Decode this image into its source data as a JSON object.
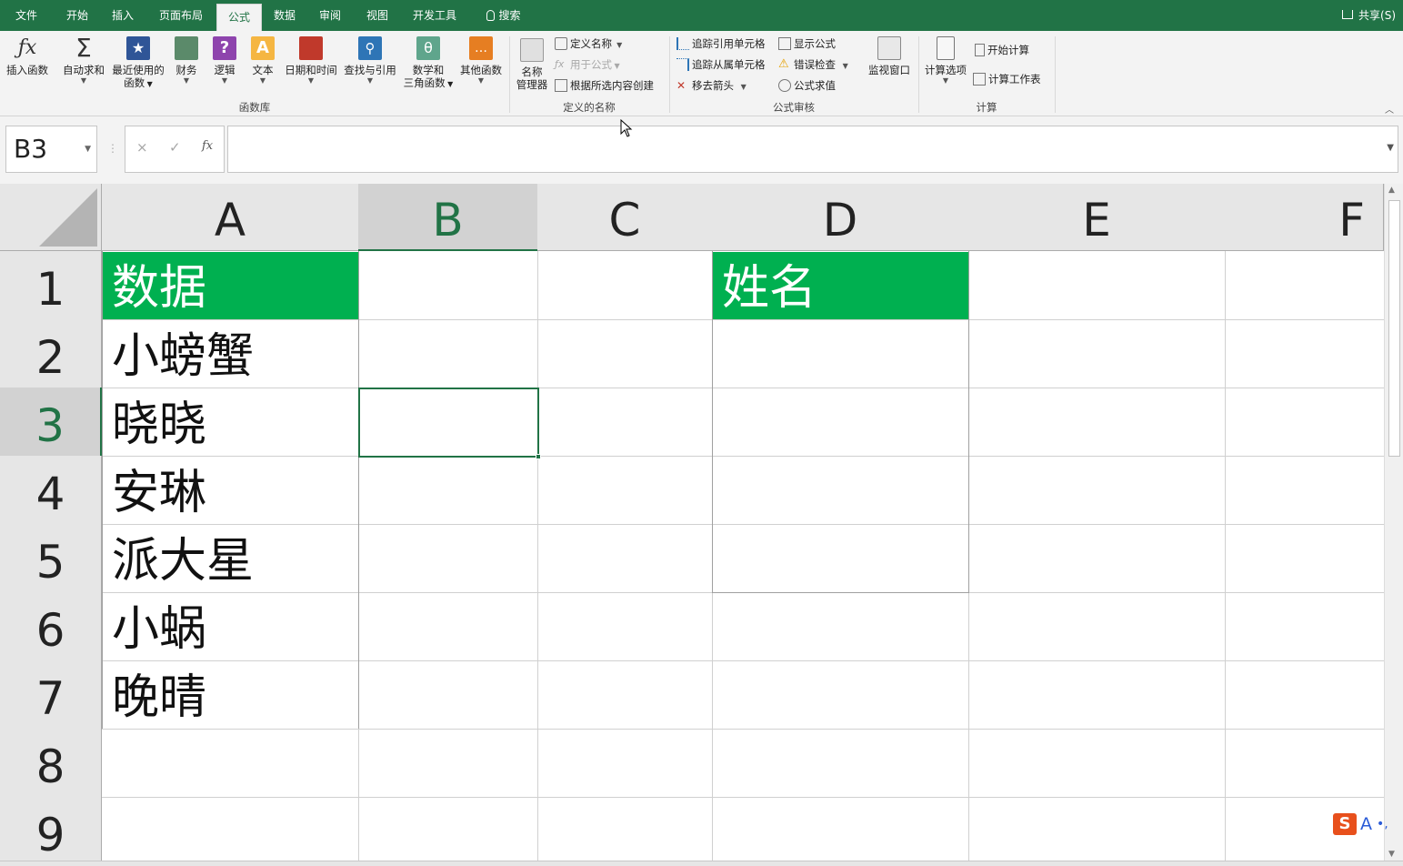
{
  "tabs": [
    {
      "label": "文件"
    },
    {
      "label": "开始"
    },
    {
      "label": "插入"
    },
    {
      "label": "页面布局"
    },
    {
      "label": "公式",
      "active": true
    },
    {
      "label": "数据"
    },
    {
      "label": "审阅"
    },
    {
      "label": "视图"
    },
    {
      "label": "开发工具"
    },
    {
      "label": "搜索"
    }
  ],
  "share_label": "共享(S)",
  "ribbon": {
    "insert_function": "插入函数",
    "autosum": "自动求和",
    "recent_line1": "最近使用的",
    "recent_line2": "函数",
    "financial": "财务",
    "logical": "逻辑",
    "text": "文本",
    "datetime": "日期和时间",
    "lookup": "查找与引用",
    "math_line1": "数学和",
    "math_line2": "三角函数",
    "more": "其他函数",
    "group_function_library": "函数库",
    "name_manager_line1": "名称",
    "name_manager_line2": "管理器",
    "define_name": "定义名称",
    "use_in_formula": "用于公式",
    "create_from_selection": "根据所选内容创建",
    "group_defined_names": "定义的名称",
    "trace_precedents": "追踪引用单元格",
    "trace_dependents": "追踪从属单元格",
    "remove_arrows": "移去箭头",
    "show_formulas": "显示公式",
    "error_checking": "错误检查",
    "evaluate_formula": "公式求值",
    "watch_window": "监视窗口",
    "group_formula_auditing": "公式审核",
    "calc_options": "计算选项",
    "calc_now": "开始计算",
    "calc_sheet": "计算工作表",
    "group_calculation": "计算"
  },
  "formula_bar": {
    "name_box": "B3",
    "cancel_icon": "×",
    "enter_icon": "✓",
    "fx_icon": "fx",
    "formula": ""
  },
  "columns": [
    "A",
    "B",
    "C",
    "D",
    "E",
    "F"
  ],
  "rows": [
    "1",
    "2",
    "3",
    "4",
    "5",
    "6",
    "7",
    "8",
    "9"
  ],
  "cells": {
    "A1": "数据",
    "A2": "小螃蟹",
    "A3": "晓晓",
    "A4": "安琳",
    "A5": "派大星",
    "A6": "小蜗",
    "A7": "晚晴",
    "D1": "姓名"
  },
  "selected_cell": "B3",
  "colors": {
    "accent": "#217346",
    "header_fill": "#00b050",
    "header_text": "#ffffff"
  },
  "ime": {
    "s": "S",
    "a": "A",
    "dot": "•,"
  }
}
